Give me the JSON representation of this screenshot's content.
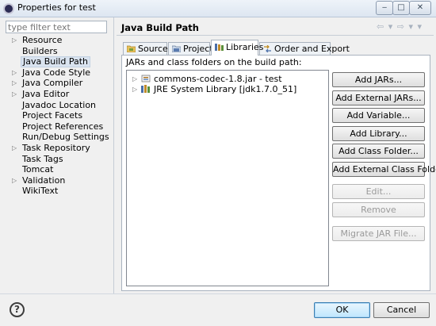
{
  "window": {
    "title": "Properties for test",
    "minimize_glyph": "‒",
    "maximize_glyph": "□",
    "close_glyph": "✕"
  },
  "filter": {
    "placeholder": "type filter text"
  },
  "nav": {
    "items": [
      {
        "label": "Resource",
        "expandable": true
      },
      {
        "label": "Builders",
        "expandable": false
      },
      {
        "label": "Java Build Path",
        "expandable": false,
        "selected": true
      },
      {
        "label": "Java Code Style",
        "expandable": true
      },
      {
        "label": "Java Compiler",
        "expandable": true
      },
      {
        "label": "Java Editor",
        "expandable": true
      },
      {
        "label": "Javadoc Location",
        "expandable": false
      },
      {
        "label": "Project Facets",
        "expandable": false
      },
      {
        "label": "Project References",
        "expandable": false
      },
      {
        "label": "Run/Debug Settings",
        "expandable": false
      },
      {
        "label": "Task Repository",
        "expandable": true
      },
      {
        "label": "Task Tags",
        "expandable": false
      },
      {
        "label": "Tomcat",
        "expandable": false
      },
      {
        "label": "Validation",
        "expandable": true
      },
      {
        "label": "WikiText",
        "expandable": false
      }
    ]
  },
  "page": {
    "title": "Java Build Path",
    "back_arrows": "⇦ ▾ ⇨ ▾ ▾"
  },
  "tabs": {
    "source": "Source",
    "projects": "Projects",
    "libraries": "Libraries",
    "order": "Order and Export"
  },
  "libraries": {
    "heading": "JARs and class folders on the build path:",
    "entries": [
      {
        "label": "commons-codec-1.8.jar - test",
        "icon": "jar-icon"
      },
      {
        "label": "JRE System Library [jdk1.7.0_51]",
        "icon": "library-icon"
      }
    ]
  },
  "buttons": {
    "add_jars": "Add JARs...",
    "add_external_jars": "Add External JARs...",
    "add_variable": "Add Variable...",
    "add_library": "Add Library...",
    "add_class_folder": "Add Class Folder...",
    "add_external_class_folder": "Add External Class Folder...",
    "edit": "Edit...",
    "remove": "Remove",
    "migrate_jar": "Migrate JAR File..."
  },
  "footer": {
    "help_glyph": "?",
    "ok": "OK",
    "cancel": "Cancel"
  },
  "colors": {
    "selection": "#d9e3ef",
    "ok_button": "#bee6fd"
  }
}
